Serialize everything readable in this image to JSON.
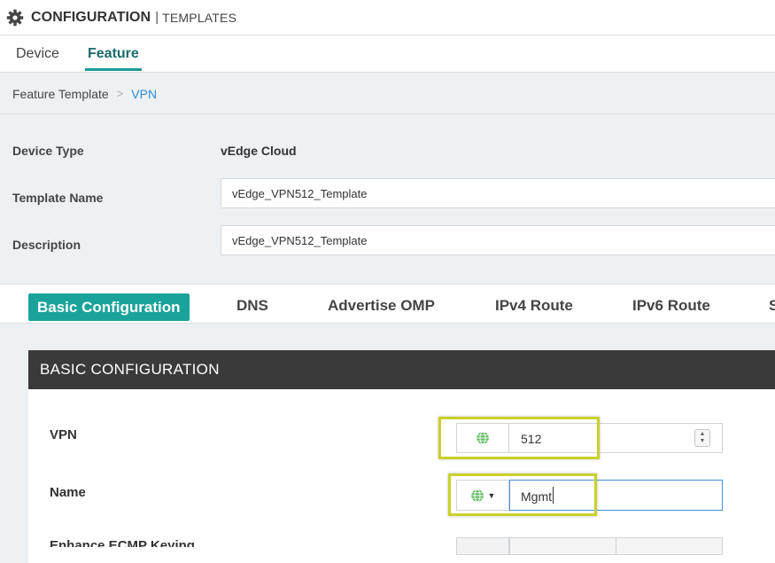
{
  "header": {
    "icon": "gear-icon",
    "title": "CONFIGURATION",
    "separator": "|",
    "subtitle": "TEMPLATES"
  },
  "top_tabs": [
    {
      "label": "Device"
    },
    {
      "label": "Feature"
    }
  ],
  "breadcrumb": {
    "parent": "Feature Template",
    "separator": ">",
    "current": "VPN"
  },
  "form": {
    "device_type_label": "Device Type",
    "device_type_value": "vEdge Cloud",
    "template_name_label": "Template Name",
    "template_name_value": "vEdge_VPN512_Template",
    "description_label": "Description",
    "description_value": "vEdge_VPN512_Template"
  },
  "sub_tabs": [
    {
      "label": "Basic Configuration"
    },
    {
      "label": "DNS"
    },
    {
      "label": "Advertise OMP"
    },
    {
      "label": "IPv4 Route"
    },
    {
      "label": "IPv6 Route"
    },
    {
      "label": "S"
    }
  ],
  "basic_config": {
    "heading": "BASIC CONFIGURATION",
    "vpn_label": "VPN",
    "vpn_value": "512",
    "name_label": "Name",
    "name_value": "Mgmt",
    "third_label": "Enhance ECMP Keying"
  },
  "colors": {
    "accent": "#1aa39a",
    "link": "#2a8cd6",
    "highlight": "#c9d12a",
    "panel_header": "#3a3a3a",
    "globe": "#5cb85c"
  }
}
